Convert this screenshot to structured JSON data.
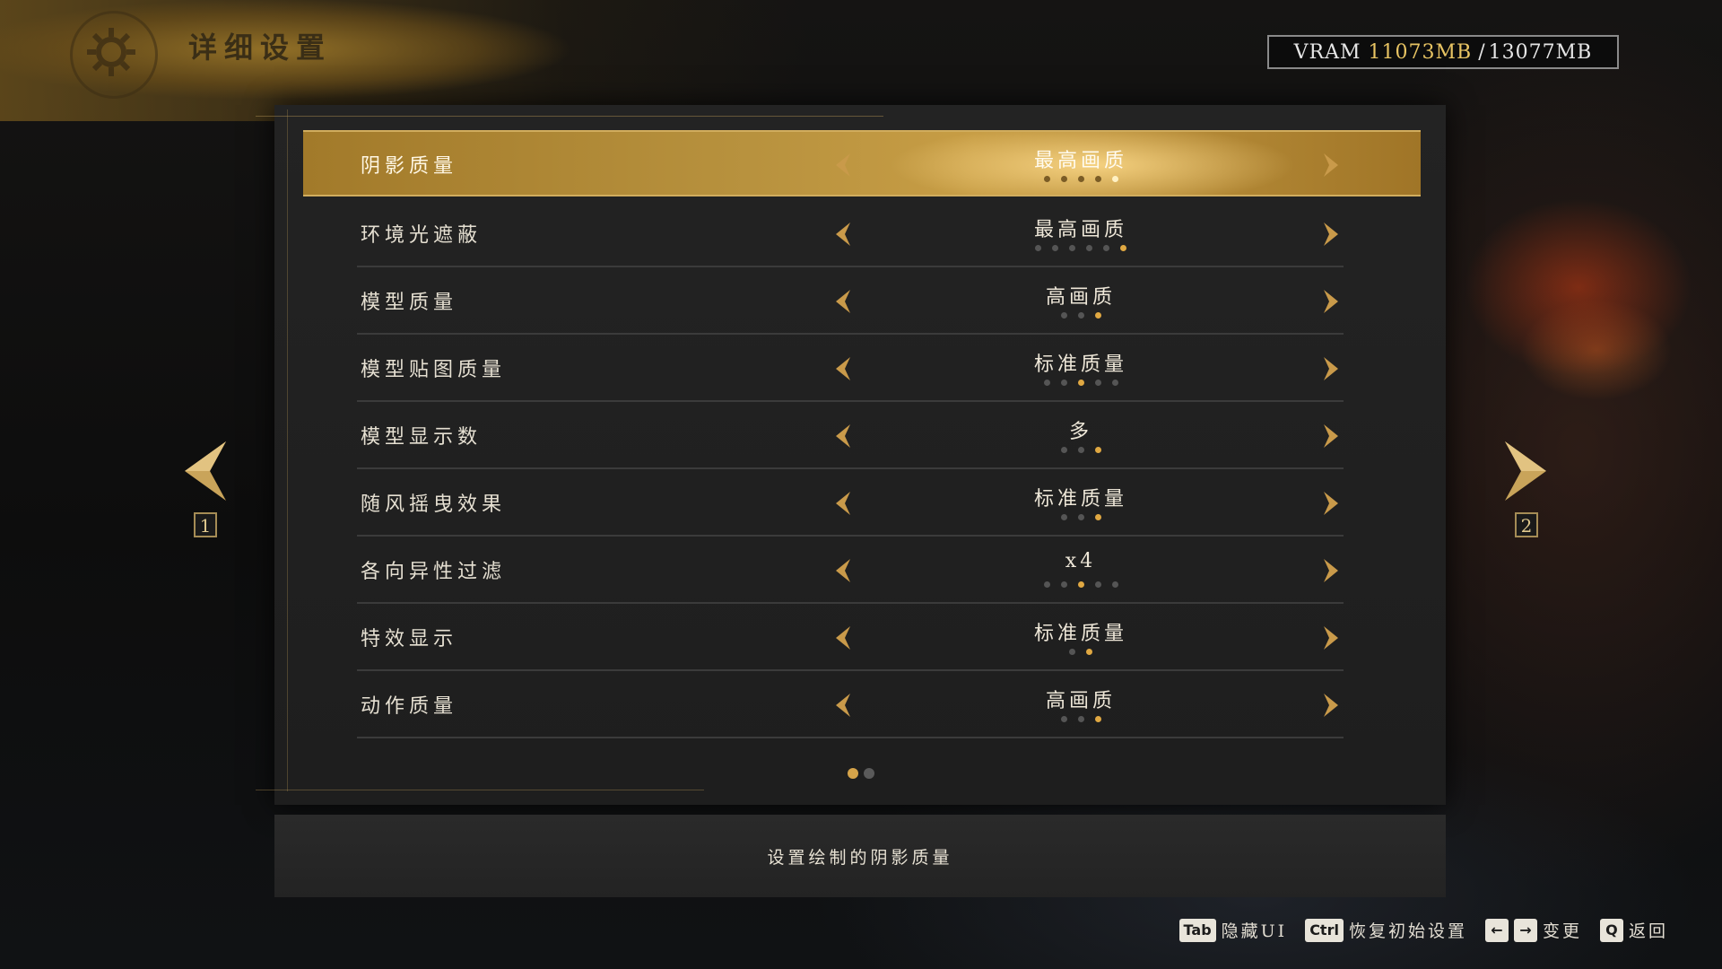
{
  "header": {
    "title": "详细设置"
  },
  "vram": {
    "label": "VRAM",
    "used": "11073MB",
    "separator": "/",
    "total": "13077MB"
  },
  "settings": [
    {
      "label": "阴影质量",
      "value": "最高画质",
      "levels": 5,
      "level": 5,
      "selected": true
    },
    {
      "label": "环境光遮蔽",
      "value": "最高画质",
      "levels": 6,
      "level": 6,
      "selected": false
    },
    {
      "label": "模型质量",
      "value": "高画质",
      "levels": 3,
      "level": 3,
      "selected": false
    },
    {
      "label": "模型贴图质量",
      "value": "标准质量",
      "levels": 5,
      "level": 3,
      "selected": false
    },
    {
      "label": "模型显示数",
      "value": "多",
      "levels": 3,
      "level": 3,
      "selected": false
    },
    {
      "label": "随风摇曳效果",
      "value": "标准质量",
      "levels": 3,
      "level": 3,
      "selected": false
    },
    {
      "label": "各向异性过滤",
      "value": "x4",
      "levels": 5,
      "level": 3,
      "selected": false
    },
    {
      "label": "特效显示",
      "value": "标准质量",
      "levels": 2,
      "level": 2,
      "selected": false
    },
    {
      "label": "动作质量",
      "value": "高画质",
      "levels": 3,
      "level": 3,
      "selected": false
    }
  ],
  "pagination": {
    "pages": 2,
    "current": 1,
    "prev_page": "1",
    "next_page": "2"
  },
  "description": "设置绘制的阴影质量",
  "footer": {
    "hide_ui_key": "Tab",
    "hide_ui_label": "隐藏UI",
    "reset_key": "Ctrl",
    "reset_label": "恢复初始设置",
    "change_key_left": "←",
    "change_key_right": "→",
    "change_label": "变更",
    "back_key": "Q",
    "back_label": "返回"
  },
  "colors": {
    "accent": "#d6a44a",
    "selected_row": "#b8923e",
    "panel": "#222222"
  },
  "icons": {
    "header": "gear-icon",
    "prev": "chevron-left-icon",
    "next": "chevron-right-icon"
  }
}
